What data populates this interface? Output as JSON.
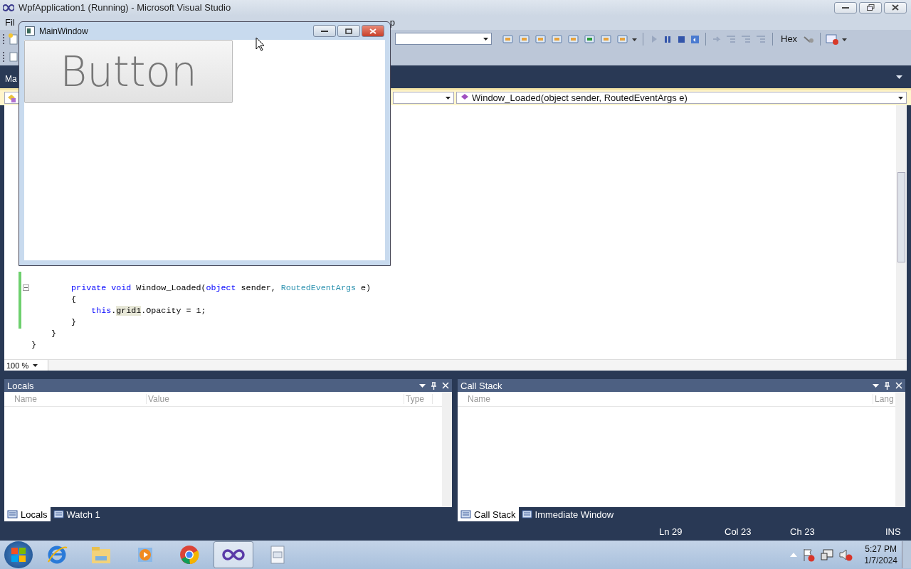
{
  "window": {
    "title": "WpfApplication1 (Running) - Microsoft Visual Studio"
  },
  "menu": [
    {
      "label": "Fil"
    },
    {
      "label": "p"
    }
  ],
  "toolbar": {
    "hex_label": "Hex"
  },
  "document_tab": {
    "label": "Ma"
  },
  "navigation": {
    "member": "Window_Loaded(object sender, RoutedEventArgs e)"
  },
  "code_lines": [
    {
      "kind": "blank"
    },
    {
      "kind": "blank"
    },
    {
      "kind": "code",
      "fold": true,
      "tokens": [
        {
          "text": "        private void",
          "kind": "keyword"
        },
        {
          "text": " Window_Loaded(",
          "kind": "plain"
        },
        {
          "text": "object",
          "kind": "keyword"
        },
        {
          "text": " sender, ",
          "kind": "plain"
        },
        {
          "text": "RoutedEventArgs",
          "kind": "type"
        },
        {
          "text": " e)",
          "kind": "plain"
        }
      ]
    },
    {
      "kind": "code",
      "tokens": [
        {
          "text": "        {",
          "kind": "plain"
        }
      ]
    },
    {
      "kind": "code",
      "tokens": [
        {
          "text": "            this",
          "kind": "keyword"
        },
        {
          "text": ".",
          "kind": "plain"
        },
        {
          "text": "grid1",
          "kind": "highlight"
        },
        {
          "text": ".Opacity = 1;",
          "kind": "plain"
        }
      ]
    },
    {
      "kind": "code",
      "tokens": [
        {
          "text": "        }",
          "kind": "plain"
        }
      ]
    },
    {
      "kind": "code",
      "tokens": [
        {
          "text": "    }",
          "kind": "plain"
        }
      ]
    },
    {
      "kind": "code",
      "tokens": [
        {
          "text": "}",
          "kind": "plain"
        }
      ]
    }
  ],
  "zoom": {
    "value": "100 %"
  },
  "panels": [
    {
      "title": "Locals",
      "columns": [
        "Name",
        "Value",
        "Type"
      ],
      "tabs": [
        {
          "label": "Locals",
          "selected": true
        },
        {
          "label": "Watch 1",
          "selected": false
        }
      ]
    },
    {
      "title": "Call Stack",
      "columns": [
        "Name",
        "Lang"
      ],
      "tabs": [
        {
          "label": "Call Stack",
          "selected": true
        },
        {
          "label": "Immediate Window",
          "selected": false
        }
      ]
    }
  ],
  "status_bar": {
    "line": "Ln 29",
    "column": "Col 23",
    "char": "Ch 23",
    "mode": "INS"
  },
  "running_window": {
    "title": "MainWindow",
    "button_label": "Button"
  },
  "taskbar": {
    "apps": [
      {
        "kind": "browser",
        "selected": false
      },
      {
        "kind": "folder",
        "selected": false
      },
      {
        "kind": "media",
        "selected": false
      },
      {
        "kind": "chrome",
        "selected": false
      },
      {
        "kind": "studio",
        "selected": true
      },
      {
        "kind": "document",
        "selected": false
      }
    ],
    "time": "5:27 PM",
    "date": "1/7/2024"
  }
}
